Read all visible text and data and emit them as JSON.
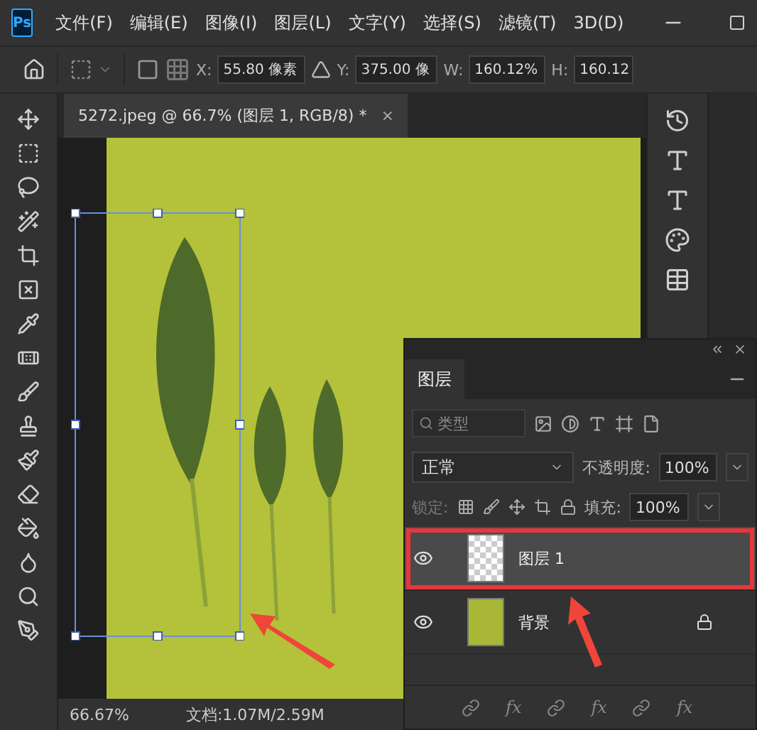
{
  "app": {
    "logo": "Ps",
    "menu": [
      "文件(F)",
      "编辑(E)",
      "图像(I)",
      "图层(L)",
      "文字(Y)",
      "选择(S)",
      "滤镜(T)",
      "3D(D)"
    ]
  },
  "options_bar": {
    "x_label": "X:",
    "x_value": "55.80 像素",
    "y_label": "Y:",
    "y_value": "375.00 像",
    "w_label": "W:",
    "w_value": "160.12%",
    "h_label": "H:",
    "h_value": "160.12"
  },
  "document_tab": {
    "title": "5272.jpeg @ 66.7% (图层 1, RGB/8) *",
    "close": "×"
  },
  "status_bar": {
    "zoom": "66.67%",
    "doc_size": "文档:1.07M/2.59M"
  },
  "layers_panel": {
    "tab": "图层",
    "filter": {
      "placeholder": "类型"
    },
    "blend_mode": "正常",
    "opacity_label": "不透明度:",
    "opacity": "100%",
    "lock_label": "锁定:",
    "fill_label": "填充:",
    "fill": "100%",
    "layers": [
      {
        "name": "图层 1",
        "kind": "transparent",
        "selected": true,
        "visible": true,
        "locked": false
      },
      {
        "name": "背景",
        "kind": "image",
        "selected": false,
        "visible": true,
        "locked": true
      }
    ],
    "footer": [
      "fx",
      "fx",
      "fx"
    ]
  }
}
